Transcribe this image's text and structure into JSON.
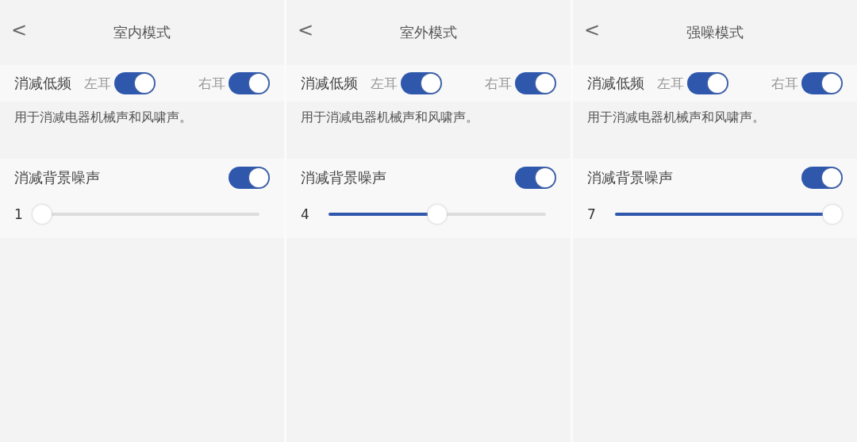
{
  "panels": [
    {
      "back": "<",
      "title": "室内模式",
      "low_freq": {
        "label": "消减低频",
        "left": {
          "label": "左耳",
          "on": true
        },
        "right": {
          "label": "右耳",
          "on": true
        }
      },
      "description": "用于消减电器机械声和风啸声。",
      "noise": {
        "label": "消减背景噪声",
        "on": true,
        "value": "1",
        "level": 0
      }
    },
    {
      "back": "<",
      "title": "室外模式",
      "low_freq": {
        "label": "消减低频",
        "left": {
          "label": "左耳",
          "on": true
        },
        "right": {
          "label": "右耳",
          "on": true
        }
      },
      "description": "用于消减电器机械声和风啸声。",
      "noise": {
        "label": "消减背景噪声",
        "on": true,
        "value": "4",
        "level": 0.5
      }
    },
    {
      "back": "<",
      "title": "强噪模式",
      "low_freq": {
        "label": "消减低频",
        "left": {
          "label": "左耳",
          "on": true
        },
        "right": {
          "label": "右耳",
          "on": true
        }
      },
      "description": "用于消减电器机械声和风啸声。",
      "noise": {
        "label": "消减背景噪声",
        "on": true,
        "value": "7",
        "level": 1
      }
    }
  ]
}
